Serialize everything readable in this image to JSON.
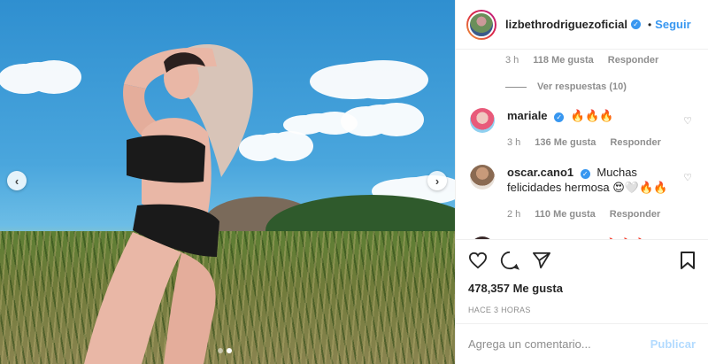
{
  "header": {
    "username": "lizbethrodriguezoficial",
    "verified_icon": "verified-badge-icon",
    "separator": "•",
    "follow_label": "Seguir"
  },
  "top_meta": {
    "time": "3 h",
    "likes": "118 Me gusta",
    "reply": "Responder"
  },
  "view_replies": "Ver respuestas (10)",
  "comments": [
    {
      "user": "mariale",
      "text": "🔥🔥🔥",
      "time": "3 h",
      "likes": "136 Me gusta",
      "reply": "Responder"
    },
    {
      "user": "oscar.cano1",
      "text": "Muchas felicidades hermosa 😍🤍🔥🔥",
      "time": "2 h",
      "likes": "110 Me gusta",
      "reply": "Responder"
    },
    {
      "user": "mariaenayatv",
      "text": "🔥🔥🔥"
    }
  ],
  "actions": {
    "like_icon": "heart-icon",
    "comment_icon": "comment-icon",
    "share_icon": "share-icon",
    "save_icon": "bookmark-icon"
  },
  "likes_count": "478,357 Me gusta",
  "post_time": "HACE 3 HORAS",
  "comment_box": {
    "placeholder": "Agrega un comentario...",
    "publish_label": "Publicar"
  },
  "media": {
    "prev_icon": "‹",
    "next_icon": "›",
    "carousel_count": 2,
    "carousel_active": 1
  },
  "colors": {
    "link": "#3897f0",
    "publish_disabled": "#b3dbff",
    "secondary_text": "#8e8e8e"
  }
}
